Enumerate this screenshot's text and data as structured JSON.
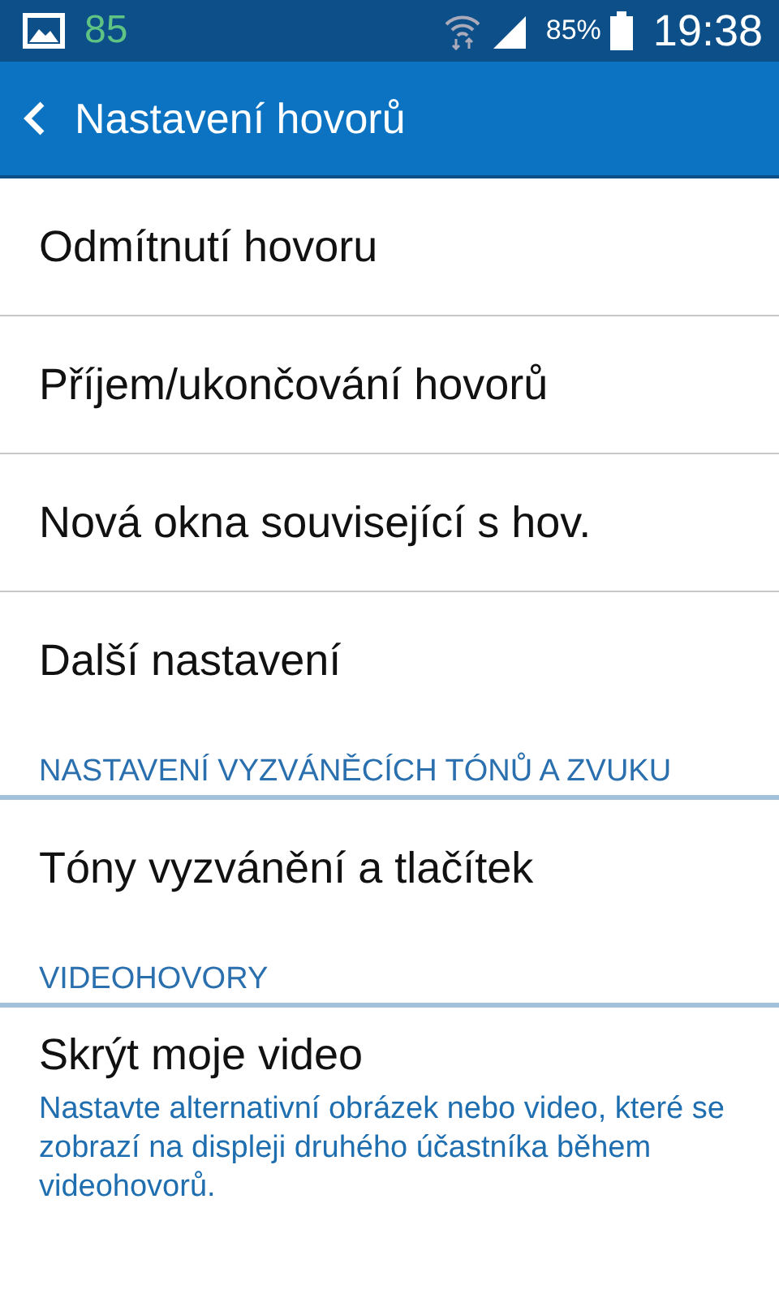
{
  "status_bar": {
    "notification_count": "85",
    "battery": "85%",
    "time": "19:38"
  },
  "action_bar": {
    "title": "Nastavení hovorů"
  },
  "items": [
    {
      "kind": "item",
      "title": "Odmítnutí hovoru"
    },
    {
      "kind": "item",
      "title": "Příjem/ukončování hovorů"
    },
    {
      "kind": "item",
      "title": "Nová okna související s hov."
    },
    {
      "kind": "item",
      "title": "Další nastavení"
    },
    {
      "kind": "header",
      "title": "NASTAVENÍ VYZVÁNĚCÍCH TÓNŮ A ZVUKU"
    },
    {
      "kind": "item",
      "title": "Tóny vyzvánění a tlačítek"
    },
    {
      "kind": "header",
      "title": "VIDEOHOVORY"
    },
    {
      "kind": "item",
      "title": "Skrýt moje video",
      "summary": "Nastavte alternativní obrázek nebo video, které se zobrazí na displeji druhého účastníka během videohovorů."
    }
  ]
}
